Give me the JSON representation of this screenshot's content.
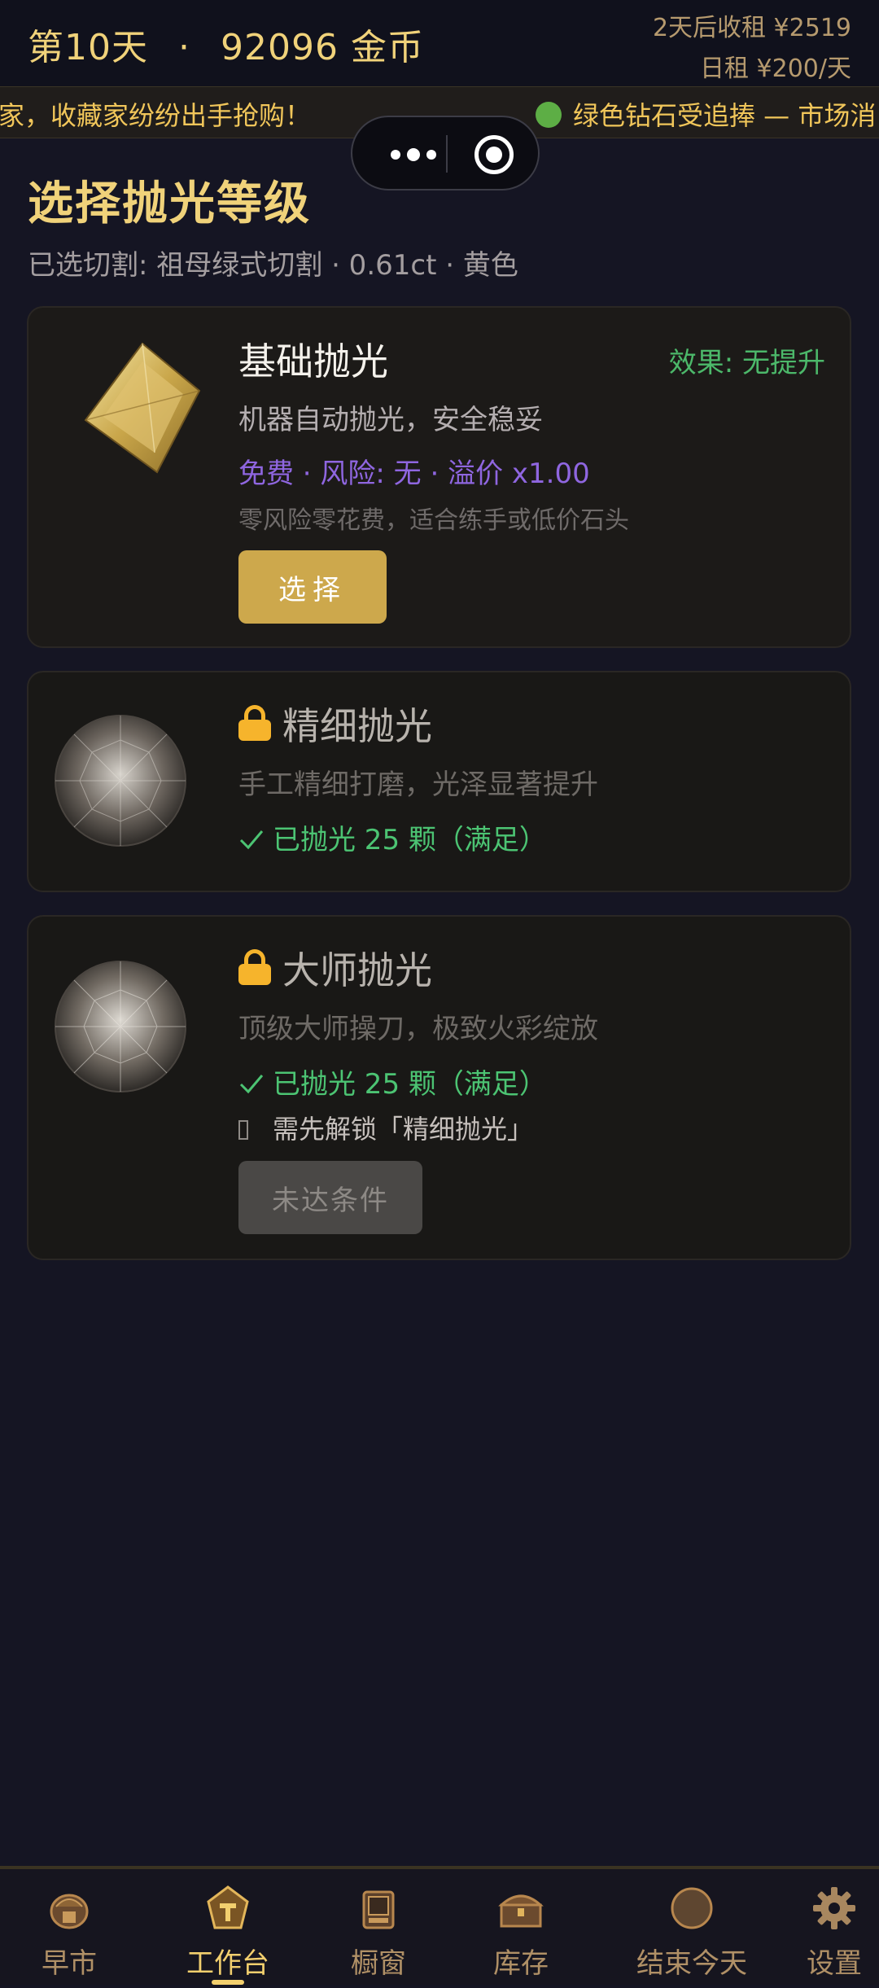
{
  "header": {
    "day_label": "第10天",
    "separator": "·",
    "gold": "92096 金币",
    "rent_due": "2天后收租 ¥2519",
    "daily_rent": "日租 ¥200/天"
  },
  "ticker": {
    "segment_1": "家，收藏家纷纷出手抢购！",
    "segment_2": "绿色钻石受追捧 — 市场消"
  },
  "page": {
    "title": "选择抛光等级",
    "subtitle": "已选切割: 祖母绿式切割 · 0.61ct · 黄色"
  },
  "options": [
    {
      "title": "基础抛光",
      "effect": "效果: 无提升",
      "desc": "机器自动抛光，安全稳妥",
      "price": "免费 · 风险: 无 · 溢价 x1.00",
      "note": "零风险零花费，适合练手或低价石头",
      "button": "选择",
      "icon": "yellow-diamond-icon"
    },
    {
      "title": "精细抛光",
      "desc": "手工精细打磨，光泽显著提升",
      "requirement": "已抛光 25 颗（满足）",
      "icon": "round-diamond-icon"
    },
    {
      "title": "大师抛光",
      "desc": "顶级大师操刀，极致火彩绽放",
      "requirement": "已抛光 25 颗（满足）",
      "prerequisite": "需先解锁「精细抛光」",
      "button": "未达条件",
      "icon": "round-diamond-icon"
    }
  ],
  "tabbar": {
    "items": [
      {
        "label": "早市",
        "icon": "market-icon"
      },
      {
        "label": "工作台",
        "icon": "workbench-icon",
        "active": true
      },
      {
        "label": "橱窗",
        "icon": "showcase-icon"
      },
      {
        "label": "库存",
        "icon": "treasure-chest-icon"
      },
      {
        "label": "结束今天",
        "icon": "moon-icon"
      },
      {
        "label": "设置",
        "icon": "gear-icon"
      }
    ]
  },
  "colors": {
    "background": "#151523",
    "gold_text": "#f0d27a",
    "accent_button": "#cda84c",
    "success": "#4cc473",
    "price_purple": "#8f66e0",
    "lock": "#f6b42c"
  }
}
